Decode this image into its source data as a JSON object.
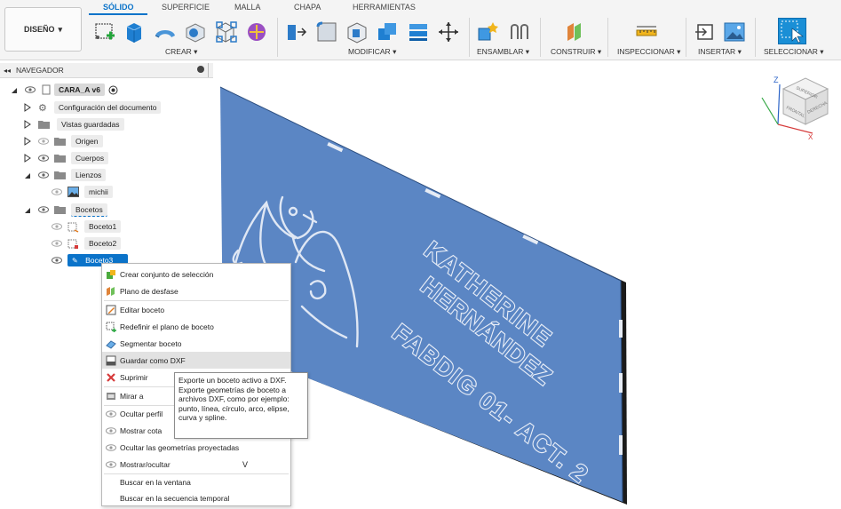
{
  "toolbar": {
    "design_label": "DISEÑO",
    "tabs": [
      "SÓLIDO",
      "SUPERFICIE",
      "MALLA",
      "CHAPA",
      "HERRAMIENTAS"
    ],
    "groups": [
      "CREAR",
      "MODIFICAR",
      "ENSAMBLAR",
      "CONSTRUIR",
      "INSPECCIONAR",
      "INSERTAR",
      "SELECCIONAR"
    ]
  },
  "browser": {
    "title": "NAVEGADOR",
    "root": "CARA_A v6",
    "items": [
      "Configuración del documento",
      "Vistas guardadas",
      "Origen",
      "Cuerpos",
      "Lienzos",
      "michii",
      "Bocetos",
      "Boceto1",
      "Boceto2",
      "Boceto3"
    ]
  },
  "plate_text": {
    "line1": "KATHERINE",
    "line2": "HERNÁNDEZ",
    "line3": "FABDIG 01- ACT. 2"
  },
  "viewcube": {
    "axis_z": "Z",
    "axis_x": "X",
    "face_front": "FRONTAL",
    "face_right": "DERECHA",
    "face_top": "SUPERIOR"
  },
  "context_menu": {
    "items": [
      {
        "label": "Crear conjunto de selección",
        "icon": "selection-set-icon"
      },
      {
        "label": "Plano de desfase",
        "icon": "offset-plane-icon"
      },
      {
        "label": "Editar boceto",
        "icon": "edit-sketch-icon"
      },
      {
        "label": "Redefinir el plano de boceto",
        "icon": "redefine-plane-icon"
      },
      {
        "label": "Segmentar boceto",
        "icon": "slice-sketch-icon"
      },
      {
        "label": "Guardar como DXF",
        "icon": "dxf-icon"
      },
      {
        "label": "Suprimir",
        "icon": "delete-icon"
      },
      {
        "label": "Mirar a",
        "icon": "look-at-icon"
      },
      {
        "label": "Ocultar perfil",
        "icon": "eye-icon"
      },
      {
        "label": "Mostrar cota",
        "icon": "eye-icon"
      },
      {
        "label": "Ocultar las geometrías proyectadas",
        "icon": "eye-icon"
      },
      {
        "label": "Mostrar/ocultar",
        "icon": "eye-icon",
        "shortcut": "V"
      },
      {
        "label": "Buscar en la ventana",
        "icon": ""
      },
      {
        "label": "Buscar en la secuencia temporal",
        "icon": ""
      }
    ]
  },
  "tooltip": {
    "text": "Exporte un boceto activo a DXF. Exporte geometrías de boceto a archivos DXF, como por ejemplo: punto, línea, círculo, arco, elipse, curva y spline."
  },
  "colors": {
    "accent": "#0b73c9",
    "plate": "#5b86c4"
  }
}
